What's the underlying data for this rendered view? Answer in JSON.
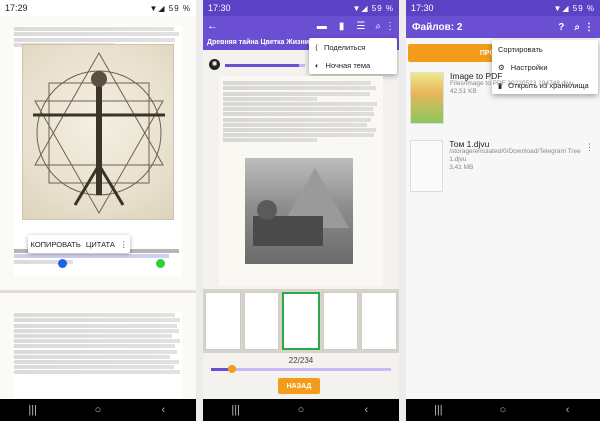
{
  "panel1": {
    "status_time": "17:29",
    "status_battery": "59 %",
    "selection_menu": {
      "copy": "КОПИРОВАТЬ",
      "quote": "ЦИТАТА",
      "more": "⋮"
    },
    "handle_colors": [
      "#1e62e8",
      "#2fcf3c"
    ]
  },
  "panel2": {
    "status_time": "17:30",
    "status_battery": "59 %",
    "book_title": "Древняя тайна Цветка Жизни",
    "menu": {
      "share": "Поделиться",
      "night": "Ночная тема"
    },
    "page_indicator": "22/234",
    "back_button": "НАЗАД",
    "accent": "#6a4fd3",
    "button_color": "#f39c1b"
  },
  "panel3": {
    "status_time": "17:30",
    "status_battery": "59 %",
    "title": "Файлов: 2",
    "button_partial": "ПРОС",
    "menu": {
      "sort": "Сортировать",
      "settings": "Настройки",
      "open_storage": "Открыть из хранилища"
    },
    "files": [
      {
        "name": "Image to PDF",
        "path": "Files/Image to PDF 20220523 194748.djvu",
        "size": "42,51 KB"
      },
      {
        "name": "Том 1.djvu",
        "path": "/storage/emulated/0/Download/Telegram Tree 1.djvu",
        "size": "3,41 MB"
      }
    ]
  },
  "nav_icons": [
    "menu-icon",
    "home-icon",
    "back-icon"
  ]
}
